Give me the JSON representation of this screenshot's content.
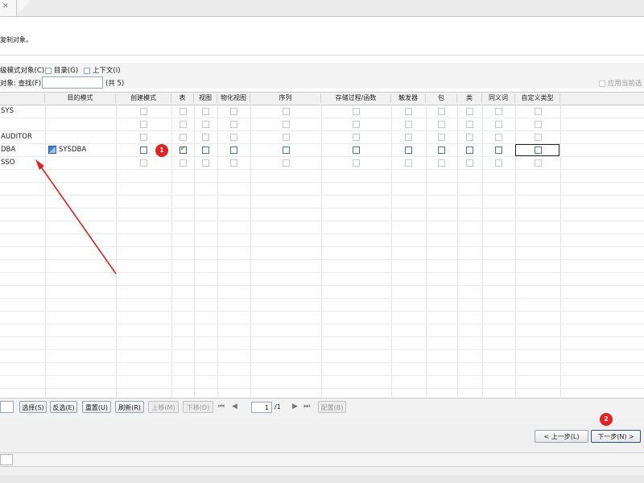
{
  "header": {
    "description": "复制对象。"
  },
  "options": {
    "schema_objects_label": "级模式对象(C)",
    "catalog_label": "目录(G)",
    "context_label": "上下文(I)",
    "find_prefix": "对象: 查找(F):",
    "find_value": "",
    "count": "(共 5)",
    "apply_current_label": "应用当前选"
  },
  "table": {
    "columns": [
      "",
      "目的模式",
      "创建模式",
      "表",
      "视图",
      "物化视图",
      "序列",
      "存储过程/函数",
      "触发器",
      "包",
      "类",
      "同义词",
      "自定义类型"
    ],
    "rows": [
      {
        "name": "SYS",
        "target": "",
        "checks": [
          false,
          false,
          false,
          false,
          false,
          false,
          false,
          false,
          false,
          false,
          false
        ],
        "active": false
      },
      {
        "name": "",
        "target": "",
        "checks": [
          false,
          false,
          false,
          false,
          false,
          false,
          false,
          false,
          false,
          false,
          false
        ],
        "active": false
      },
      {
        "name": "AUDITOR",
        "target": "",
        "checks": [
          false,
          false,
          false,
          false,
          false,
          false,
          false,
          false,
          false,
          false,
          false
        ],
        "active": false
      },
      {
        "name": "DBA",
        "target": "SYSDBA",
        "checks": [
          false,
          true,
          false,
          false,
          false,
          false,
          false,
          false,
          false,
          false,
          false
        ],
        "active": true
      },
      {
        "name": "SSO",
        "target": "",
        "checks": [
          false,
          false,
          false,
          false,
          false,
          false,
          false,
          false,
          false,
          false,
          false
        ],
        "active": false
      }
    ]
  },
  "badges": {
    "one": "1",
    "two": "2"
  },
  "toolbar": {
    "select_label": "选择(S)",
    "invert_label": "反选(E)",
    "reset_label": "重置(U)",
    "refresh_label": "刷新(R)",
    "move_up_label": "上移(M)",
    "move_down_label": "下移(D)",
    "page_value": "1",
    "page_total": "/1",
    "config_label": "配置(B)"
  },
  "footer": {
    "prev_label": "< 上一步(L)",
    "next_label": "下一步(N) >"
  },
  "colors": {
    "annotation_red": "#e3211f",
    "checked_green": "#1f8a1f"
  }
}
